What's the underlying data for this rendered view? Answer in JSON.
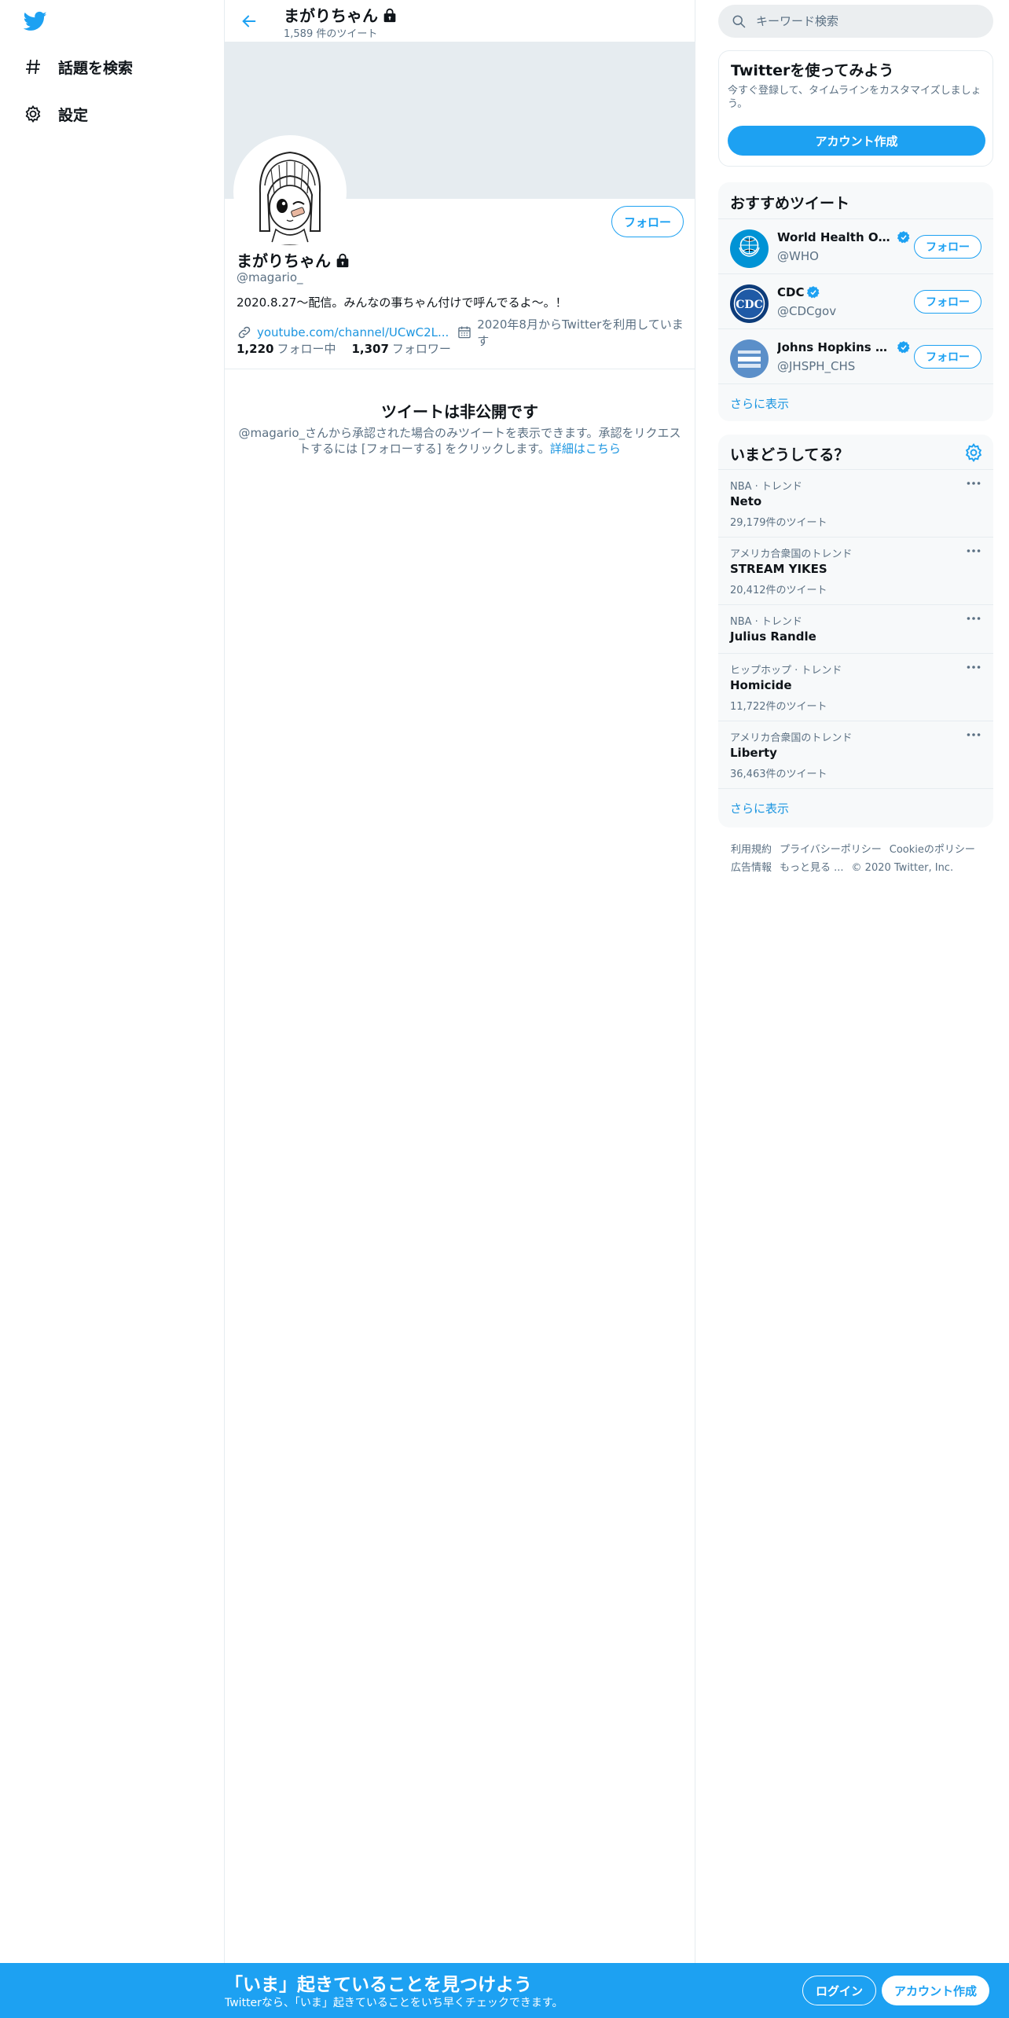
{
  "colors": {
    "accent": "#1da1f2",
    "link": "#1b95e0",
    "secondary_text": "#5b7083",
    "banner": "#e6ecf0"
  },
  "nav": {
    "logo_icon": "twitter-bird-icon",
    "items": [
      {
        "icon": "hashtag-icon",
        "label": "話題を検索"
      },
      {
        "icon": "gear-icon",
        "label": "設定"
      }
    ]
  },
  "profile": {
    "top_name": "まがりちゃん",
    "tweet_count": "1,589 件のツイート",
    "follow_button": "フォロー",
    "name": "まがりちゃん",
    "handle": "@magario_",
    "bio": "2020.8.27〜配信。みんなの事ちゃん付けで呼んでるよ〜。！",
    "link": "youtube.com/channel/UCwC2L...",
    "joined": "2020年8月からTwitterを利用しています",
    "following_count": "1,220",
    "following_label": "フォロー中",
    "followers_count": "1,307",
    "followers_label": "フォロワー",
    "private_title": "ツイートは非公開です",
    "private_text": "@magario_さんから承認された場合のみツイートを表示できます。承認をリクエストするには [フォローする] をクリックします。",
    "private_link": "詳細はこちら"
  },
  "search": {
    "placeholder": "キーワード検索"
  },
  "signup_card": {
    "title": "Twitterを使ってみよう",
    "subtitle": "今すぐ登録して、タイムラインをカスタマイズしましょう。",
    "button": "アカウント作成"
  },
  "recommended": {
    "title": "おすすめツイート",
    "accounts": [
      {
        "name": "World Health Orga...",
        "handle": "@WHO",
        "follow": "フォロー",
        "avatar_label": "World Health Organization"
      },
      {
        "name": "CDC",
        "handle": "@CDCgov",
        "follow": "フォロー",
        "avatar_label": "CDC"
      },
      {
        "name": "Johns Hopkins Ce...",
        "handle": "@JHSPH_CHS",
        "follow": "フォロー",
        "avatar_label": "Center for Health Security"
      }
    ],
    "more": "さらに表示"
  },
  "trends": {
    "title": "いまどうしてる？",
    "items": [
      {
        "category": "NBA · トレンド",
        "name": "Neto",
        "count": "29,179件のツイート"
      },
      {
        "category": "アメリカ合衆国のトレンド",
        "name": "STREAM YIKES",
        "count": "20,412件のツイート"
      },
      {
        "category": "NBA · トレンド",
        "name": "Julius Randle",
        "count": ""
      },
      {
        "category": "ヒップホップ · トレンド",
        "name": "Homicide",
        "count": "11,722件のツイート"
      },
      {
        "category": "アメリカ合衆国のトレンド",
        "name": "Liberty",
        "count": "36,463件のツイート"
      }
    ],
    "more": "さらに表示"
  },
  "footer": {
    "links": [
      "利用規約",
      "プライバシーポリシー",
      "Cookieのポリシー",
      "広告情報",
      "もっと見る ..."
    ],
    "copyright": "© 2020 Twitter, Inc."
  },
  "bottom_bar": {
    "title": "「いま」起きていることを見つけよう",
    "subtitle": "Twitterなら、「いま」起きていることをいち早くチェックできます。",
    "login": "ログイン",
    "signup": "アカウント作成"
  }
}
